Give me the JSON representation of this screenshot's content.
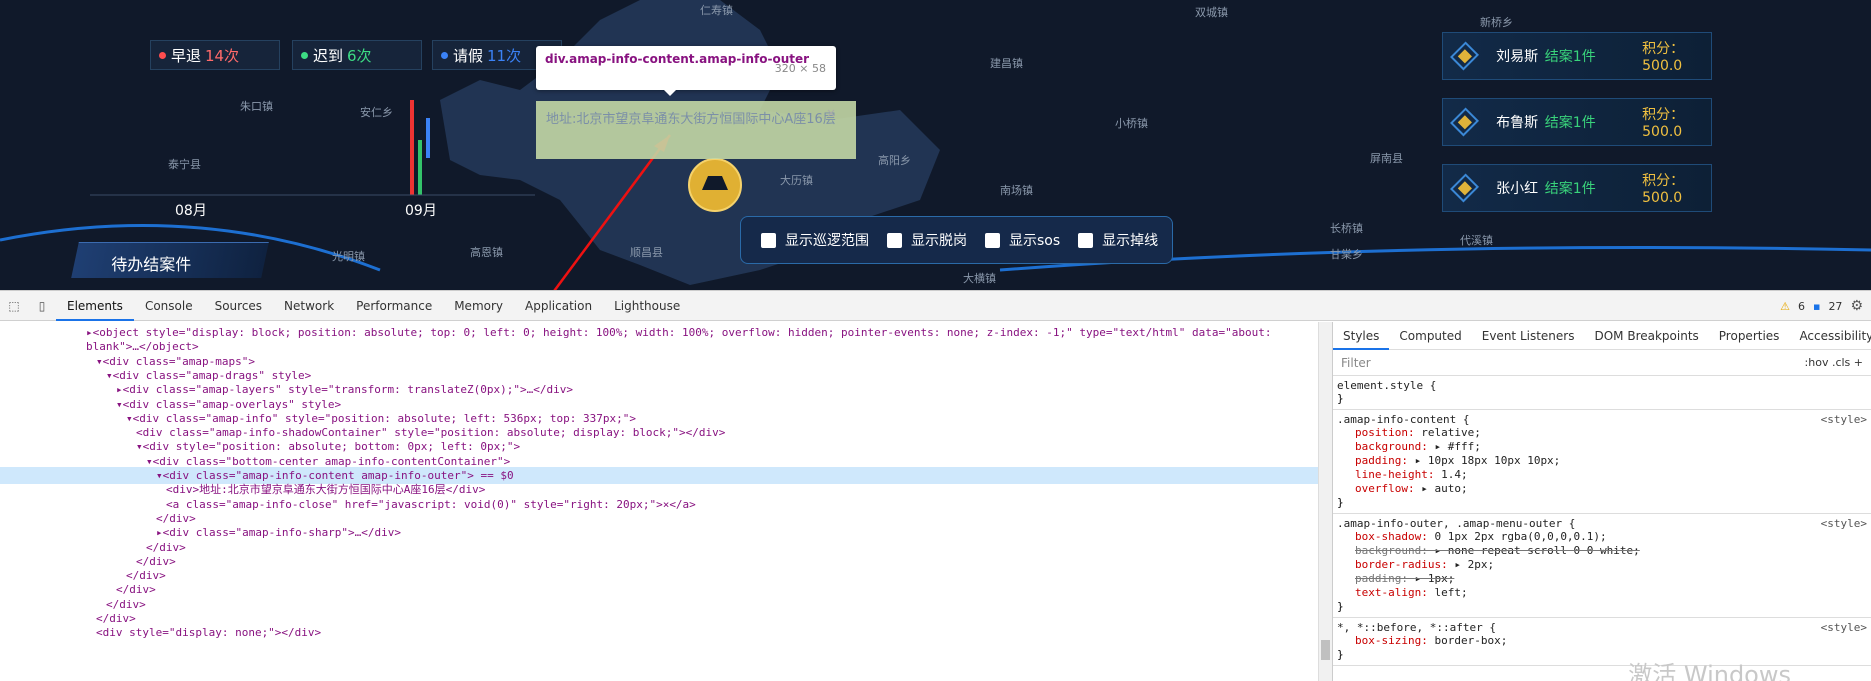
{
  "dashboard": {
    "stats": [
      {
        "label": "早退",
        "value": "14次",
        "dot_color": "#ff4d4f",
        "value_color": "#ff6a6a"
      },
      {
        "label": "迟到",
        "value": "6次",
        "dot_color": "#3ddc84",
        "value_color": "#3ddc84"
      },
      {
        "label": "请假",
        "value": "11次",
        "dot_color": "#3b82f6",
        "value_color": "#3b82f6"
      }
    ],
    "months": [
      "08月",
      "09月"
    ],
    "pending_title": "待办结案件",
    "ranking": [
      {
        "name": "刘易斯",
        "cases": "结案1件",
        "score": "积分：500.0"
      },
      {
        "name": "布鲁斯",
        "cases": "结案1件",
        "score": "积分：500.0"
      },
      {
        "name": "张小红",
        "cases": "结案1件",
        "score": "积分：500.0"
      }
    ],
    "checkboxes": [
      "显示巡逻范围",
      "显示脱岗",
      "显示sos",
      "显示掉线"
    ],
    "map_labels": [
      "仁寿镇",
      "建昌镇",
      "顺昌县",
      "南场镇",
      "高阳乡",
      "大历镇",
      "小桥镇",
      "屏南县",
      "长桥镇",
      "代溪镇",
      "甘棠乡",
      "大横镇",
      "双城镇",
      "高恩镇",
      "光明镇",
      "安仁乡",
      "朱口镇",
      "泰宁县",
      "新桥乡"
    ],
    "tooltip": {
      "selector": "div.amap-info-content.amap-info-outer",
      "size": "320 × 58"
    },
    "info_content": "地址:北京市望京阜通东大街方恒国际中心A座16层",
    "info_close": "×"
  },
  "devtools": {
    "tabs": [
      "Elements",
      "Console",
      "Sources",
      "Network",
      "Performance",
      "Memory",
      "Application",
      "Lighthouse"
    ],
    "warnings": "6",
    "issues": "27",
    "dom_lines": [
      {
        "indent": 0,
        "text": "▸<object style=\"display: block; position: absolute; top: 0; left: 0; height: 100%; width: 100%; overflow: hidden; pointer-events: none; z-index: -1;\" type=\"text/html\" data=\"about:"
      },
      {
        "indent": 0,
        "text": "blank\">…</object>"
      },
      {
        "indent": 1,
        "text": "▾<div class=\"amap-maps\">"
      },
      {
        "indent": 2,
        "text": "▾<div class=\"amap-drags\" style>"
      },
      {
        "indent": 3,
        "text": "▸<div class=\"amap-layers\" style=\"transform: translateZ(0px);\">…</div>"
      },
      {
        "indent": 3,
        "text": "▾<div class=\"amap-overlays\" style>"
      },
      {
        "indent": 4,
        "text": "▾<div class=\"amap-info\" style=\"position: absolute; left: 536px; top: 337px;\">"
      },
      {
        "indent": 5,
        "text": "<div class=\"amap-info-shadowContainer\" style=\"position: absolute; display: block;\"></div>"
      },
      {
        "indent": 5,
        "text": "▾<div style=\"position: absolute; bottom: 0px; left: 0px;\">"
      },
      {
        "indent": 6,
        "text": "▾<div class=\"bottom-center amap-info-contentContainer\">"
      },
      {
        "indent": 7,
        "text": "▾<div class=\"amap-info-content amap-info-outer\"> == $0",
        "selected": true
      },
      {
        "indent": 8,
        "text": "<div>地址:北京市望京阜通东大街方恒国际中心A座16层</div>"
      },
      {
        "indent": 8,
        "text": "<a class=\"amap-info-close\" href=\"javascript: void(0)\" style=\"right: 20px;\">×</a>"
      },
      {
        "indent": 7,
        "text": "</div>"
      },
      {
        "indent": 7,
        "text": "▸<div class=\"amap-info-sharp\">…</div>"
      },
      {
        "indent": 6,
        "text": "</div>"
      },
      {
        "indent": 5,
        "text": "</div>"
      },
      {
        "indent": 4,
        "text": "</div>"
      },
      {
        "indent": 3,
        "text": "</div>"
      },
      {
        "indent": 2,
        "text": "</div>"
      },
      {
        "indent": 1,
        "text": "</div>"
      },
      {
        "indent": 1,
        "text": "<div style=\"display: none;\"></div>"
      }
    ],
    "styles_tabs": [
      "Styles",
      "Computed",
      "Event Listeners",
      "DOM Breakpoints",
      "Properties",
      "Accessibility"
    ],
    "filter_placeholder": "Filter",
    "filter_tools": ":hov  .cls  +",
    "rules": [
      {
        "selector": "element.style {",
        "source": "",
        "props": []
      },
      {
        "selector": ".amap-info-content {",
        "source": "<style>",
        "props": [
          {
            "n": "position",
            "v": "relative;",
            "s": false
          },
          {
            "n": "background",
            "v": "▸ #fff;",
            "s": false
          },
          {
            "n": "padding",
            "v": "▸ 10px 18px 10px 10px;",
            "s": false
          },
          {
            "n": "line-height",
            "v": "1.4;",
            "s": false
          },
          {
            "n": "overflow",
            "v": "▸ auto;",
            "s": false
          }
        ]
      },
      {
        "selector": ".amap-info-outer, .amap-menu-outer {",
        "source": "<style>",
        "props": [
          {
            "n": "box-shadow",
            "v": "0 1px 2px rgba(0,0,0,0.1);",
            "s": false
          },
          {
            "n": "background",
            "v": "▸ none repeat scroll 0 0 white;",
            "s": true
          },
          {
            "n": "border-radius",
            "v": "▸ 2px;",
            "s": false
          },
          {
            "n": "padding",
            "v": "▸ 1px;",
            "s": true
          },
          {
            "n": "text-align",
            "v": "left;",
            "s": false
          }
        ]
      },
      {
        "selector": "*, *::before, *::after {",
        "source": "<style>",
        "props": [
          {
            "n": "box-sizing",
            "v": "border-box;",
            "s": false
          }
        ]
      }
    ],
    "watermark": "激活 Windows"
  }
}
